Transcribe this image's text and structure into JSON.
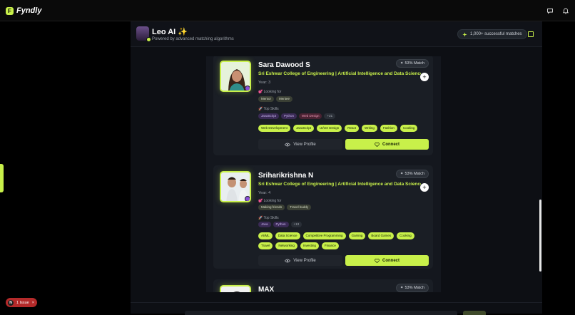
{
  "app": {
    "name": "Fyndly",
    "logo_letter": "F"
  },
  "leo": {
    "title": "Leo AI ✨",
    "subtitle": "Powered by advanced matching algorithms",
    "stat": "1,000+ successful matches"
  },
  "colors": {
    "accent": "#c8f04a",
    "background": "#000000",
    "card": "#1a1e25",
    "issue": "#b42a2a"
  },
  "labels": {
    "looking_for": "💕 Looking for",
    "top_skills": "🚀 Top Skills",
    "view_profile": "View Profile",
    "connect": "Connect"
  },
  "profiles": [
    {
      "name": "Sara Dawood S",
      "match": "53% Match",
      "college": "Sri Eshwar College of Engineering | Artificial Intelligence and Data Science",
      "year": "Year: 3",
      "looking_for": [
        "Mentor",
        "Mentee"
      ],
      "skills": [
        "JavaScript",
        "Python",
        "Web Design",
        "+21"
      ],
      "interests": [
        "Web Development",
        "JavaScript",
        "UI/UX Design",
        "React",
        "Writing",
        "Fashion",
        "Cooking"
      ]
    },
    {
      "name": "Sriharikrishna N",
      "match": "53% Match",
      "college": "Sri Eshwar College of Engineering | Artificial Intelligence and Data Science",
      "year": "Year: 4",
      "looking_for": [
        "Making friends",
        "Travel buddy"
      ],
      "skills": [
        "Java",
        "Python",
        "+13"
      ],
      "interests": [
        "AI/ML",
        "Data Science",
        "Competitive Programming",
        "Gaming",
        "Board Games",
        "Cooking",
        "Travel",
        "Networking",
        "Investing",
        "Finance"
      ]
    },
    {
      "name": "MAX",
      "match": "53% Match"
    }
  ],
  "issue": {
    "letter": "N",
    "text": "1 Issue",
    "close": "×"
  }
}
